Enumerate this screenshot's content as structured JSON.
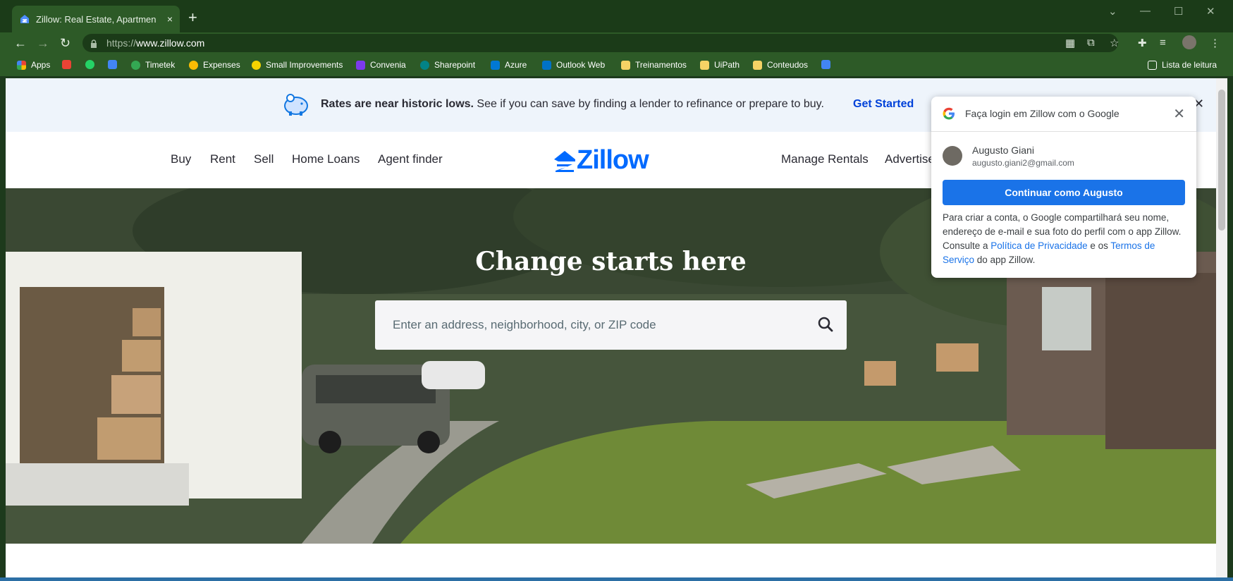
{
  "browser": {
    "tab_title": "Zillow: Real Estate, Apartments, M",
    "url_prefix": "https://",
    "url_host": "www.zillow.com",
    "new_tab_symbol": "+",
    "tab_close_symbol": "×"
  },
  "bookmarks": [
    {
      "label": "Apps",
      "color": "#ea4335"
    },
    {
      "label": "",
      "color": "#ea4335"
    },
    {
      "label": "",
      "color": "#25d366"
    },
    {
      "label": "",
      "color": "#4285f4"
    },
    {
      "label": "Timetek",
      "color": "#34a853"
    },
    {
      "label": "Expenses",
      "color": "#fbbc04"
    },
    {
      "label": "Small Improvements",
      "color": "#f5d300"
    },
    {
      "label": "Convenia",
      "color": "#7c3aed"
    },
    {
      "label": "Sharepoint",
      "color": "#038387"
    },
    {
      "label": "Azure",
      "color": "#0078d4"
    },
    {
      "label": "Outlook Web",
      "color": "#0072c6"
    },
    {
      "label": "Treinamentos",
      "color": "#f6d365"
    },
    {
      "label": "UiPath",
      "color": "#f6d365"
    },
    {
      "label": "Conteudos",
      "color": "#f6d365"
    },
    {
      "label": "",
      "color": "#4285f4"
    }
  ],
  "reading_list": "Lista de leitura",
  "banner": {
    "bold_text": "Rates are near historic lows.",
    "text": " See if you can save by finding a lender to refinance or prepare to buy.",
    "cta": "Get Started"
  },
  "nav": {
    "left": [
      "Buy",
      "Rent",
      "Sell",
      "Home Loans",
      "Agent finder"
    ],
    "right": [
      "Manage Rentals",
      "Advertise"
    ],
    "logo": "Zillow"
  },
  "hero": {
    "title": "Change starts here",
    "search_placeholder": "Enter an address, neighborhood, city, or ZIP code"
  },
  "google_popup": {
    "title": "Faça login em Zillow com o Google",
    "name": "Augusto Giani",
    "email": "augusto.giani2@gmail.com",
    "button": "Continuar como Augusto",
    "text_1": "Para criar a conta, o Google compartilhará seu nome, endereço de e-mail e sua foto do perfil com o app Zillow. Consulte a ",
    "privacy_link": "Política de Privacidade",
    "text_2": " e os ",
    "terms_link": "Termos de Serviço",
    "text_3": " do app Zillow."
  },
  "colors": {
    "browser_frame": "#1b3b18",
    "toolbar": "#2d5a27",
    "zillow_blue": "#006aff",
    "google_blue": "#1a73e8"
  }
}
